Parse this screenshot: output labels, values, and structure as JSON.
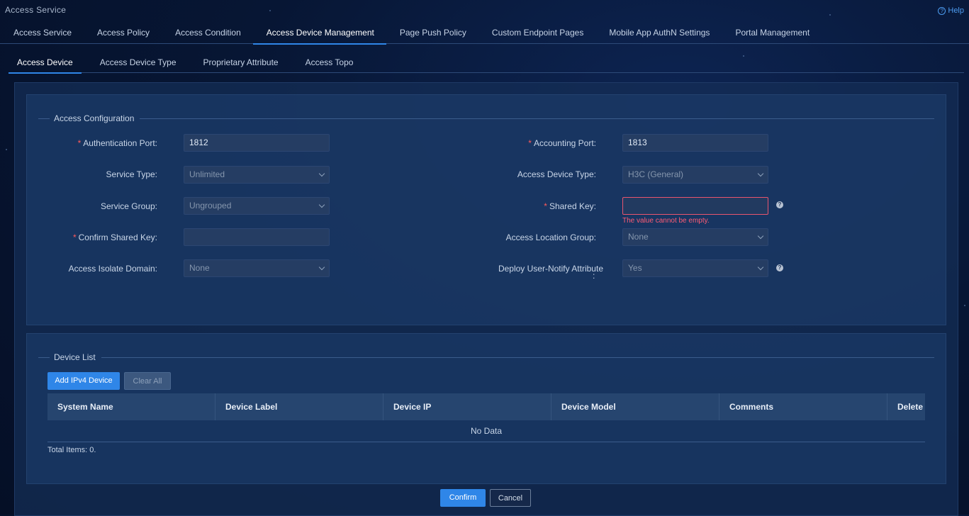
{
  "app": {
    "title": "Access Service",
    "help_label": "Help"
  },
  "nav_primary": {
    "tabs": [
      {
        "label": "Access Service"
      },
      {
        "label": "Access Policy"
      },
      {
        "label": "Access Condition"
      },
      {
        "label": "Access Device Management"
      },
      {
        "label": "Page Push Policy"
      },
      {
        "label": "Custom Endpoint Pages"
      },
      {
        "label": "Mobile App AuthN Settings"
      },
      {
        "label": "Portal Management"
      }
    ],
    "active": "Access Device Management"
  },
  "nav_secondary": {
    "tabs": [
      {
        "label": "Access Device"
      },
      {
        "label": "Access Device Type"
      },
      {
        "label": "Proprietary Attribute"
      },
      {
        "label": "Access Topo"
      }
    ],
    "active": "Access Device"
  },
  "access_config": {
    "title": "Access Configuration",
    "auth_port": {
      "label": "Authentication Port:",
      "value": "1812"
    },
    "acct_port": {
      "label": "Accounting Port:",
      "value": "1813"
    },
    "service_type": {
      "label": "Service Type:",
      "value": "Unlimited"
    },
    "access_device_type": {
      "label": "Access Device Type:",
      "value": "H3C (General)"
    },
    "service_group": {
      "label": "Service Group:",
      "value": "Ungrouped"
    },
    "shared_key": {
      "label": "Shared Key:",
      "value": "",
      "error": "The value cannot be empty."
    },
    "confirm_shared_key": {
      "label": "Confirm Shared Key:",
      "value": ""
    },
    "access_location_group": {
      "label": "Access Location Group:",
      "value": "None"
    },
    "access_isolate_domain": {
      "label": "Access Isolate Domain:",
      "value": "None"
    },
    "deploy_user_notify": {
      "label": "Deploy User-Notify Attribute",
      "label_suffix": ":",
      "value": "Yes"
    }
  },
  "device_list": {
    "title": "Device List",
    "add_button": "Add IPv4 Device",
    "clear_button": "Clear All",
    "columns": [
      "System Name",
      "Device Label",
      "Device IP",
      "Device Model",
      "Comments",
      "Delete"
    ],
    "empty_text": "No Data",
    "total": "Total Items: 0."
  },
  "footer": {
    "confirm": "Confirm",
    "cancel": "Cancel"
  },
  "colors": {
    "accent": "#2f86e8",
    "error": "#ff5c74",
    "background": "#071634"
  }
}
